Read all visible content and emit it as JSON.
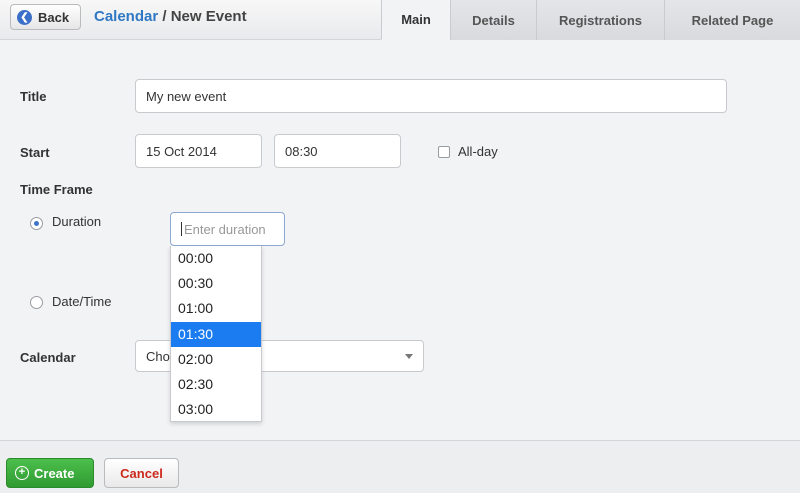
{
  "header": {
    "back_label": "Back",
    "breadcrumb_link": "Calendar",
    "breadcrumb_separator": " / ",
    "breadcrumb_current": "New Event",
    "tabs": [
      {
        "label": "Main",
        "active": true
      },
      {
        "label": "Details",
        "active": false
      },
      {
        "label": "Registrations",
        "active": false
      },
      {
        "label": "Related Page",
        "active": false
      }
    ]
  },
  "form": {
    "title_label": "Title",
    "title_value": "My new event",
    "start_label": "Start",
    "start_date": "15 Oct 2014",
    "start_time": "08:30",
    "allday_label": "All-day",
    "allday_checked": false,
    "timeframe_label": "Time Frame",
    "duration_label": "Duration",
    "duration_selected": true,
    "duration_placeholder": "Enter duration",
    "datetime_label": "Date/Time",
    "calendar_label": "Calendar",
    "calendar_value": "Cho"
  },
  "duration_dropdown": {
    "options": [
      "00:00",
      "00:30",
      "01:00",
      "01:30",
      "02:00",
      "02:30",
      "03:00"
    ],
    "highlighted": "01:30"
  },
  "footer": {
    "create_label": "Create",
    "cancel_label": "Cancel"
  },
  "colors": {
    "accent_blue": "#2f78c4",
    "highlight_blue": "#1a7cf0",
    "create_green": "#3bab3e",
    "cancel_red": "#cc2a1d"
  },
  "icons": {
    "back": "back-arrow-icon",
    "create": "plus-circle-icon",
    "select": "chevron-down-icon"
  }
}
